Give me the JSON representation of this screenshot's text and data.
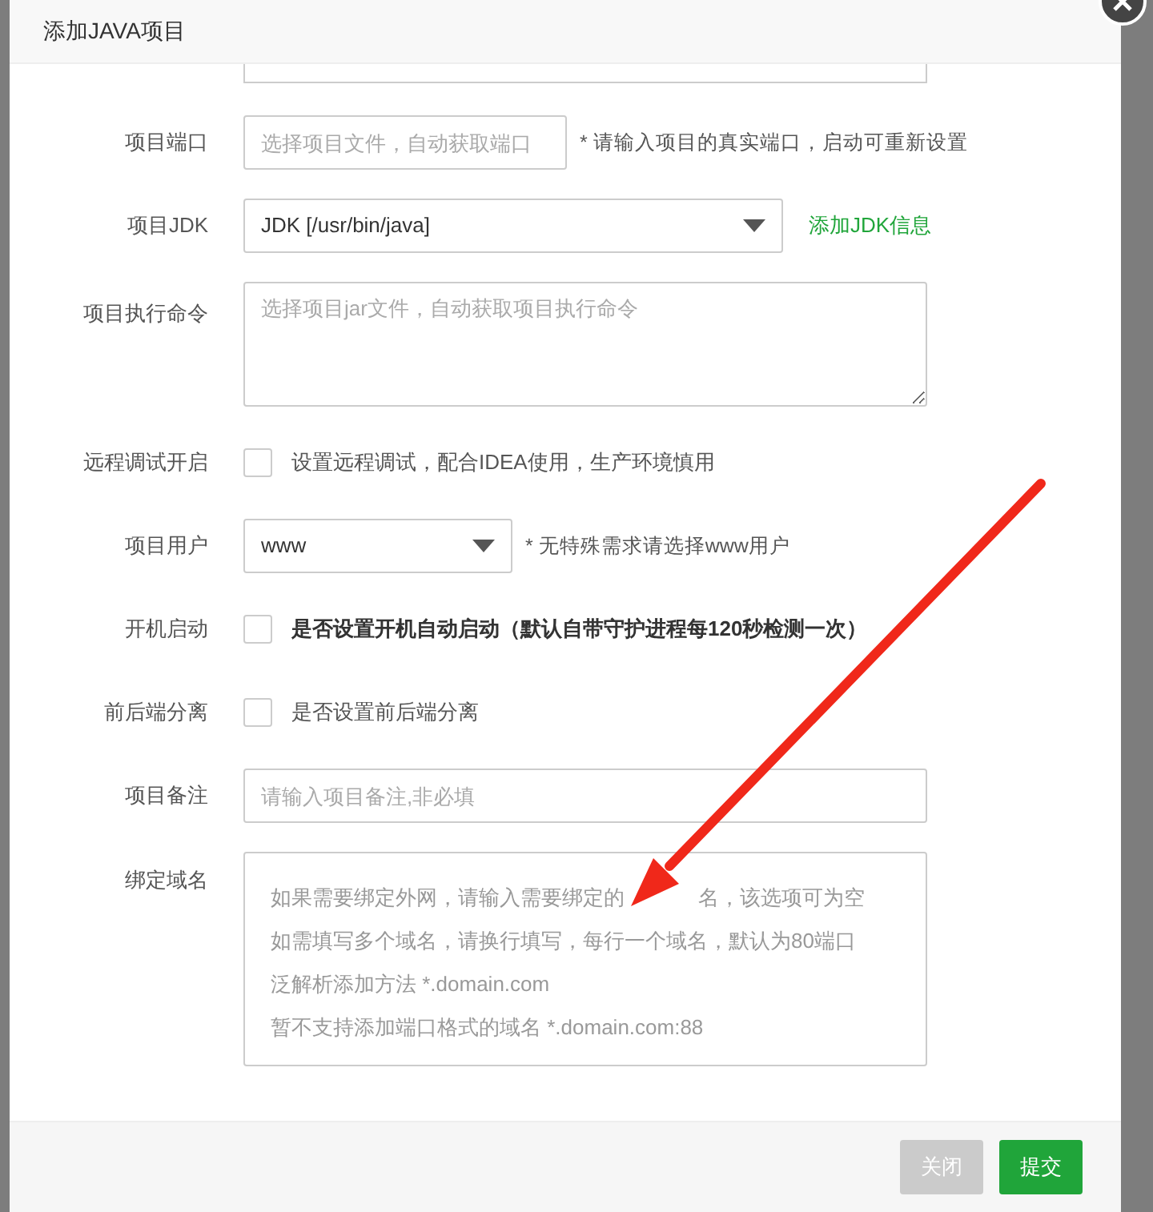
{
  "dialog": {
    "title": "添加JAVA项目"
  },
  "fields": [
    {
      "kind": "cut-input"
    },
    {
      "kind": "input",
      "label": "项目端口",
      "placeholder": "选择项目文件，自动获取端口",
      "hint": "* 请输入项目的真实端口，启动可重新设置"
    },
    {
      "kind": "select",
      "label": "项目JDK",
      "value": "JDK [/usr/bin/java]",
      "link": "添加JDK信息"
    },
    {
      "kind": "textarea",
      "label": "项目执行命令",
      "placeholder": "选择项目jar文件，自动获取项目执行命令"
    },
    {
      "kind": "checkbox",
      "label": "远程调试开启",
      "text": "设置远程调试，配合IDEA使用，生产环境慎用",
      "checked": false,
      "bold": false
    },
    {
      "kind": "select",
      "label": "项目用户",
      "value": "www",
      "hint": "* 无特殊需求请选择www用户"
    },
    {
      "kind": "checkbox",
      "label": "开机启动",
      "text": "是否设置开机自动启动（默认自带守护进程每120秒检测一次）",
      "checked": false,
      "bold": true
    },
    {
      "kind": "checkbox",
      "label": "前后端分离",
      "text": "是否设置前后端分离",
      "checked": false,
      "bold": false
    },
    {
      "kind": "input",
      "label": "项目备注",
      "placeholder": "请输入项目备注,非必填"
    },
    {
      "kind": "multiline",
      "label": "绑定域名",
      "lines": [
        [
          "如果需要绑定外网，请输入需要绑定的",
          "名，该选项可为空"
        ],
        [
          "如需填写多个域名，请换行填写，每行一个域名，默认为80端口"
        ],
        [
          "泛解析添加方法 *.domain.com"
        ],
        [
          "暂不支持添加端口格式的域名 *.domain.com:88"
        ]
      ]
    }
  ],
  "buttons": [
    {
      "label": "关闭",
      "kind": "secondary"
    },
    {
      "label": "提交",
      "kind": "primary"
    }
  ],
  "annotations": [
    {
      "kind": "arrow",
      "color": "#f0281a"
    }
  ]
}
